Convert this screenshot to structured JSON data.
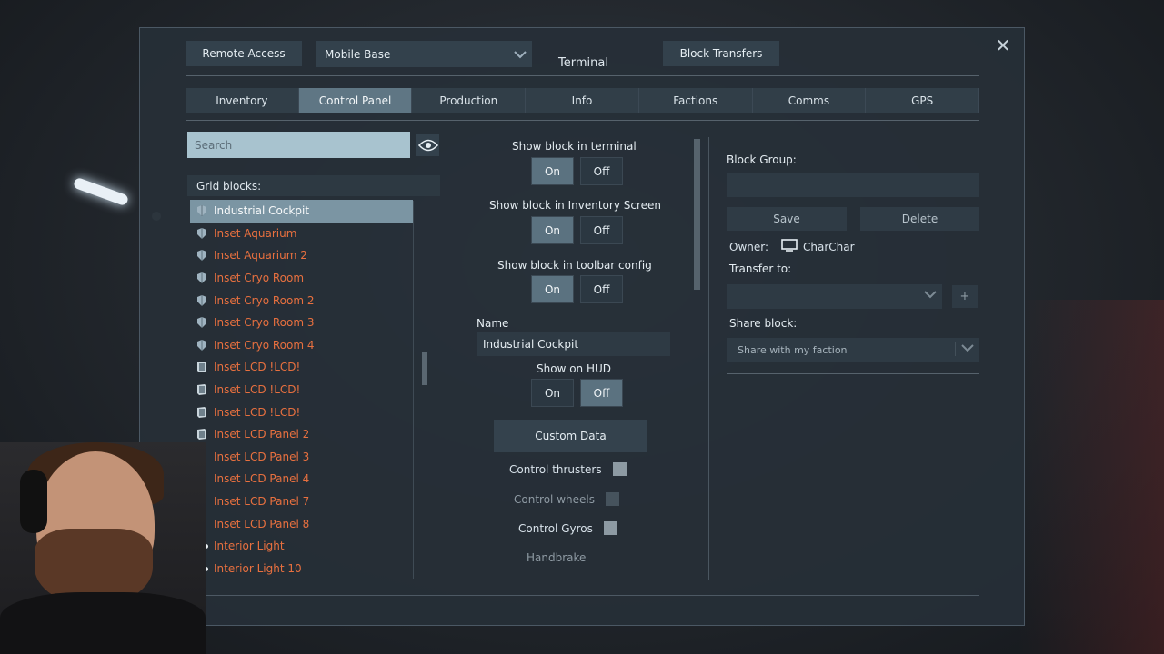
{
  "window": {
    "title": "Terminal",
    "close_symbol": "✕"
  },
  "header": {
    "remote_access_label": "Remote Access",
    "grid_selector_value": "Mobile Base",
    "block_transfers_label": "Block Transfers"
  },
  "tabs": [
    {
      "label": "Inventory",
      "active": false
    },
    {
      "label": "Control Panel",
      "active": true
    },
    {
      "label": "Production",
      "active": false
    },
    {
      "label": "Info",
      "active": false
    },
    {
      "label": "Factions",
      "active": false
    },
    {
      "label": "Comms",
      "active": false
    },
    {
      "label": "GPS",
      "active": false
    }
  ],
  "left": {
    "search_placeholder": "Search",
    "grid_blocks_label": "Grid blocks:",
    "blocks": [
      {
        "label": "Industrial Cockpit",
        "icon": "cockpit-icon",
        "selected": true
      },
      {
        "label": "Inset Aquarium",
        "icon": "cockpit-icon"
      },
      {
        "label": "Inset Aquarium 2",
        "icon": "cockpit-icon"
      },
      {
        "label": "Inset Cryo Room",
        "icon": "cockpit-icon"
      },
      {
        "label": "Inset Cryo Room 2",
        "icon": "cockpit-icon"
      },
      {
        "label": "Inset Cryo Room 3",
        "icon": "cockpit-icon"
      },
      {
        "label": "Inset Cryo Room 4",
        "icon": "cockpit-icon"
      },
      {
        "label": "Inset LCD !LCD!",
        "icon": "lcd-icon"
      },
      {
        "label": "Inset LCD !LCD!",
        "icon": "lcd-icon"
      },
      {
        "label": "Inset LCD !LCD!",
        "icon": "lcd-icon"
      },
      {
        "label": "Inset LCD Panel 2",
        "icon": "lcd-icon"
      },
      {
        "label": "Inset LCD Panel 3",
        "icon": "lcd-icon"
      },
      {
        "label": "Inset LCD Panel 4",
        "icon": "lcd-icon"
      },
      {
        "label": "Inset LCD Panel 7",
        "icon": "lcd-icon"
      },
      {
        "label": "Inset LCD Panel 8",
        "icon": "lcd-icon"
      },
      {
        "label": "Interior Light",
        "icon": "light-icon"
      },
      {
        "label": "Interior Light 10",
        "icon": "light-icon"
      }
    ]
  },
  "middle": {
    "show_in_terminal_label": "Show block in terminal",
    "show_in_inventory_label": "Show block in Inventory Screen",
    "show_in_toolbar_label": "Show block in toolbar config",
    "on_label": "On",
    "off_label": "Off",
    "name_label": "Name",
    "name_value": "Industrial Cockpit",
    "show_on_hud_label": "Show on HUD",
    "custom_data_label": "Custom Data",
    "control_thrusters_label": "Control thrusters",
    "control_wheels_label": "Control wheels",
    "control_gyros_label": "Control Gyros",
    "handbrake_label": "Handbrake"
  },
  "right": {
    "block_group_label": "Block Group:",
    "save_label": "Save",
    "delete_label": "Delete",
    "owner_label": "Owner:",
    "owner_name": "CharChar",
    "transfer_label": "Transfer to:",
    "plus_symbol": "+",
    "share_block_label": "Share block:",
    "share_value": "Share with my faction"
  },
  "colors": {
    "accent": "#5f7684",
    "list_text": "#e8703f",
    "panel_bg": "#262f37"
  }
}
